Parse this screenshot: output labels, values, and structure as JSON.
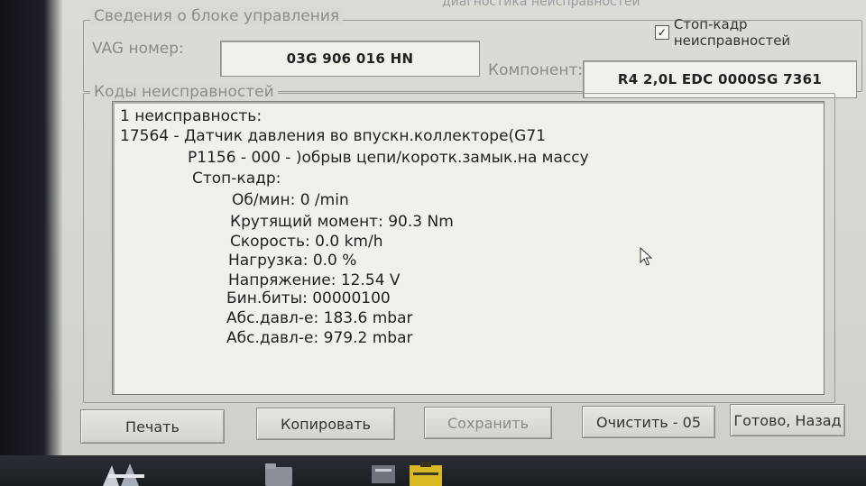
{
  "window": {
    "top_caption": "диагностика неисправностей"
  },
  "control_unit": {
    "group_title": "Сведения о блоке управления",
    "vag_label": "VAG номер:",
    "vag_value": "03G 906 016 HN",
    "component_label": "Компонент:",
    "component_value": "R4 2,0L EDC 0000SG  7361",
    "freeze_frame_checkbox_label": "Стоп-кадр неисправностей",
    "freeze_frame_checked": true
  },
  "fault_codes": {
    "group_title": "Коды неисправностей",
    "lines": [
      "1 неисправность:",
      "17564 - Датчик давления во впускн.коллекторе(G71",
      "P1156 - 000 - )обрыв цепи/коротк.замык.на массу",
      "Стоп-кадр:",
      "Об/мин: 0 /min",
      "Крутящий момент: 90.3 Nm",
      "Скорость: 0.0 km/h",
      "Нагрузка: 0.0 %",
      "Напряжение: 12.54 V",
      "Бин.биты: 00000100",
      "Абс.давл-е: 183.6 mbar",
      "Абс.давл-е: 979.2 mbar"
    ]
  },
  "buttons": {
    "print": "Печать",
    "copy": "Копировать",
    "save": "Сохранить",
    "clear": "Очистить - 05",
    "done": "Готово, Назад"
  },
  "icons": {
    "checkbox": "check-mark",
    "cursor": "mouse-pointer-icon"
  }
}
